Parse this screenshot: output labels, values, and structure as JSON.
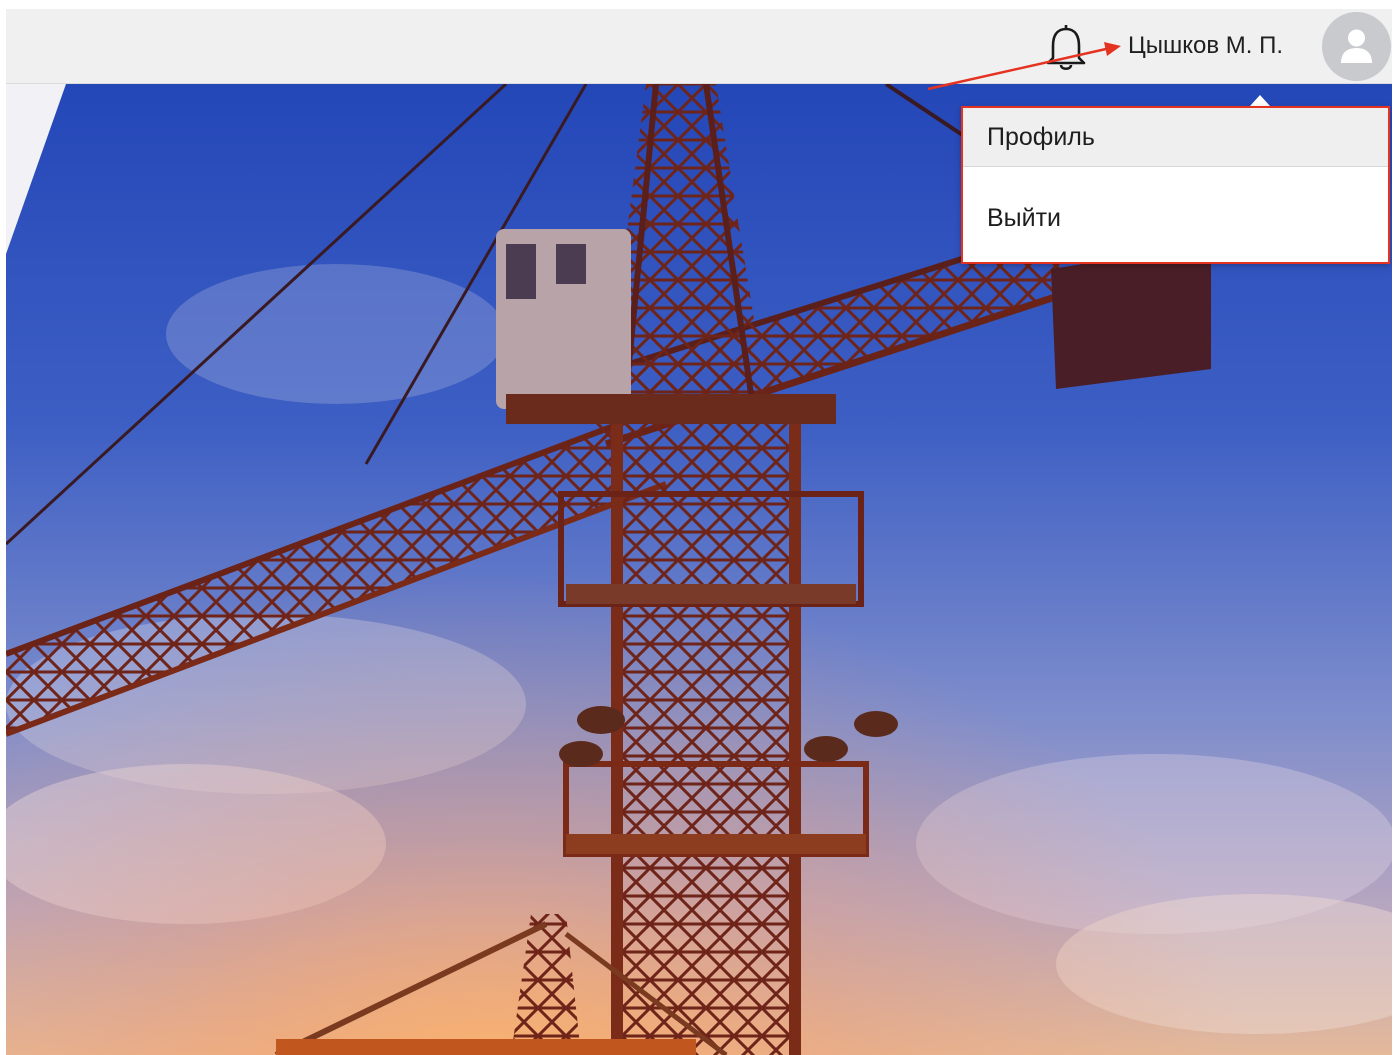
{
  "header": {
    "user_name": "Цышков М. П.",
    "icons": {
      "notifications": "bell-icon",
      "avatar": "user-avatar-icon"
    }
  },
  "user_menu": {
    "items": [
      {
        "label": "Профиль"
      },
      {
        "label": "Выйти"
      }
    ]
  },
  "hero": {
    "image": "construction-tower-crane-sunset-photo"
  },
  "colors": {
    "highlight": "#e53322",
    "header_bg": "#f0f0f0",
    "avatar_bg": "#c8cacd"
  }
}
